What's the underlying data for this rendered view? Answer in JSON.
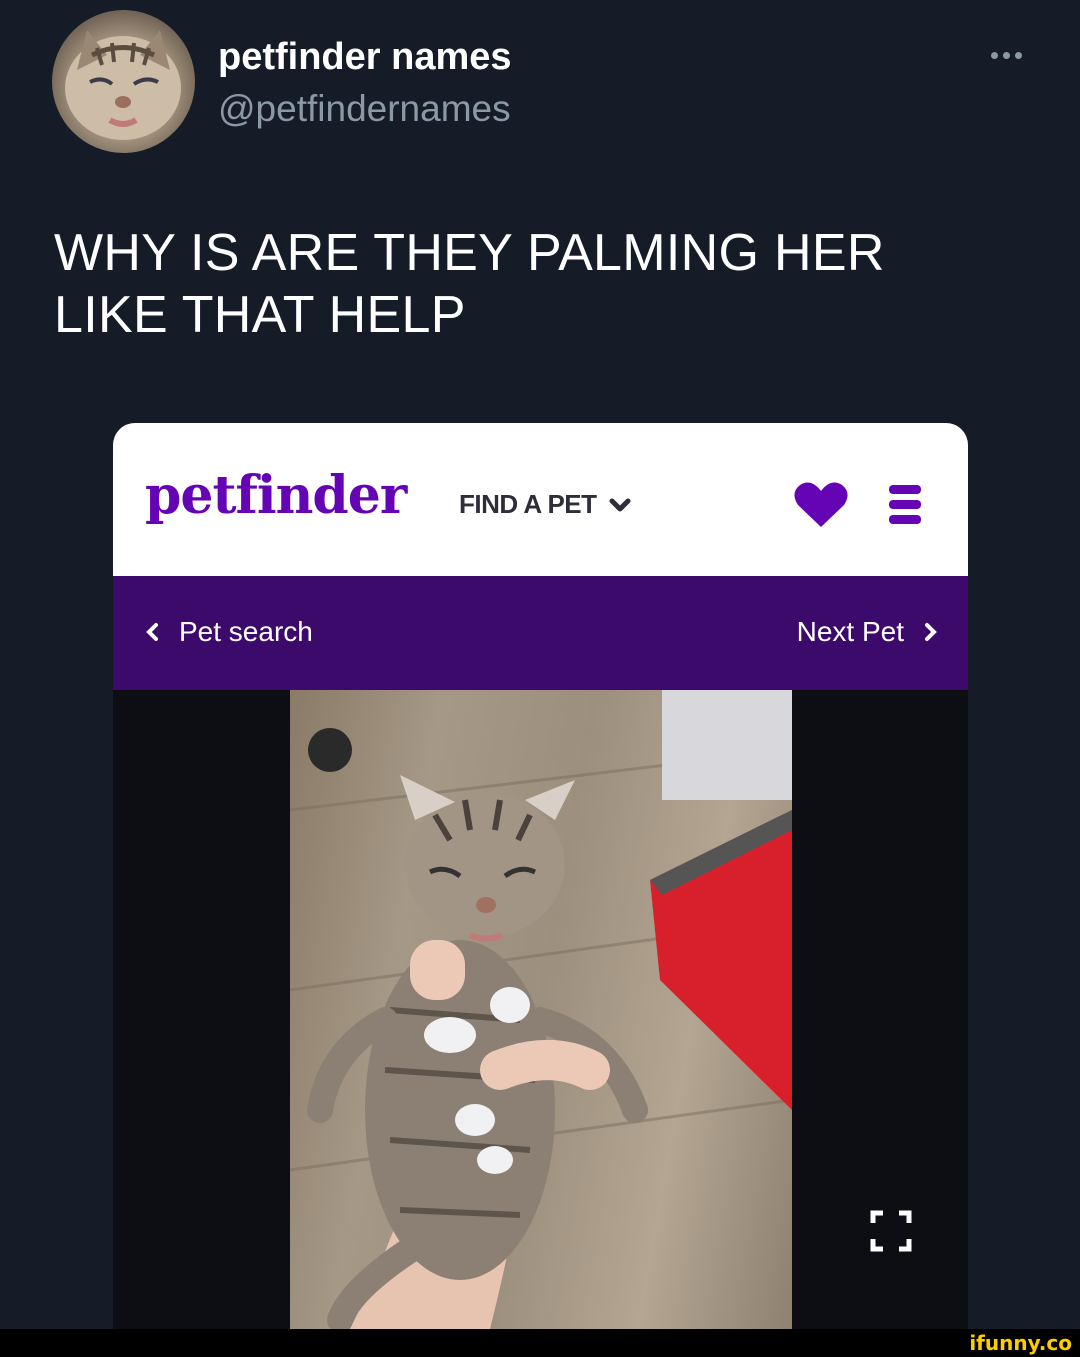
{
  "tweet": {
    "display_name": "petfinder names",
    "handle": "@petfindernames",
    "text_line1": "WHY IS ARE THEY PALMING HER",
    "text_line2": "LIKE THAT HELP",
    "more_icon": "more-horizontal-icon",
    "avatar_icon": "kitten-avatar"
  },
  "petfinder": {
    "logo": "petfinder",
    "find_a_pet": "FIND A PET",
    "brand_color": "#6504b5",
    "nav_color": "#3b0a6b",
    "back_label": "Pet search",
    "next_label": "Next Pet",
    "icons": [
      "chevron-down-icon",
      "heart-icon",
      "menu-icon",
      "chevron-left-icon",
      "chevron-right-icon",
      "expand-icon"
    ]
  },
  "watermark": "ifunny.co"
}
